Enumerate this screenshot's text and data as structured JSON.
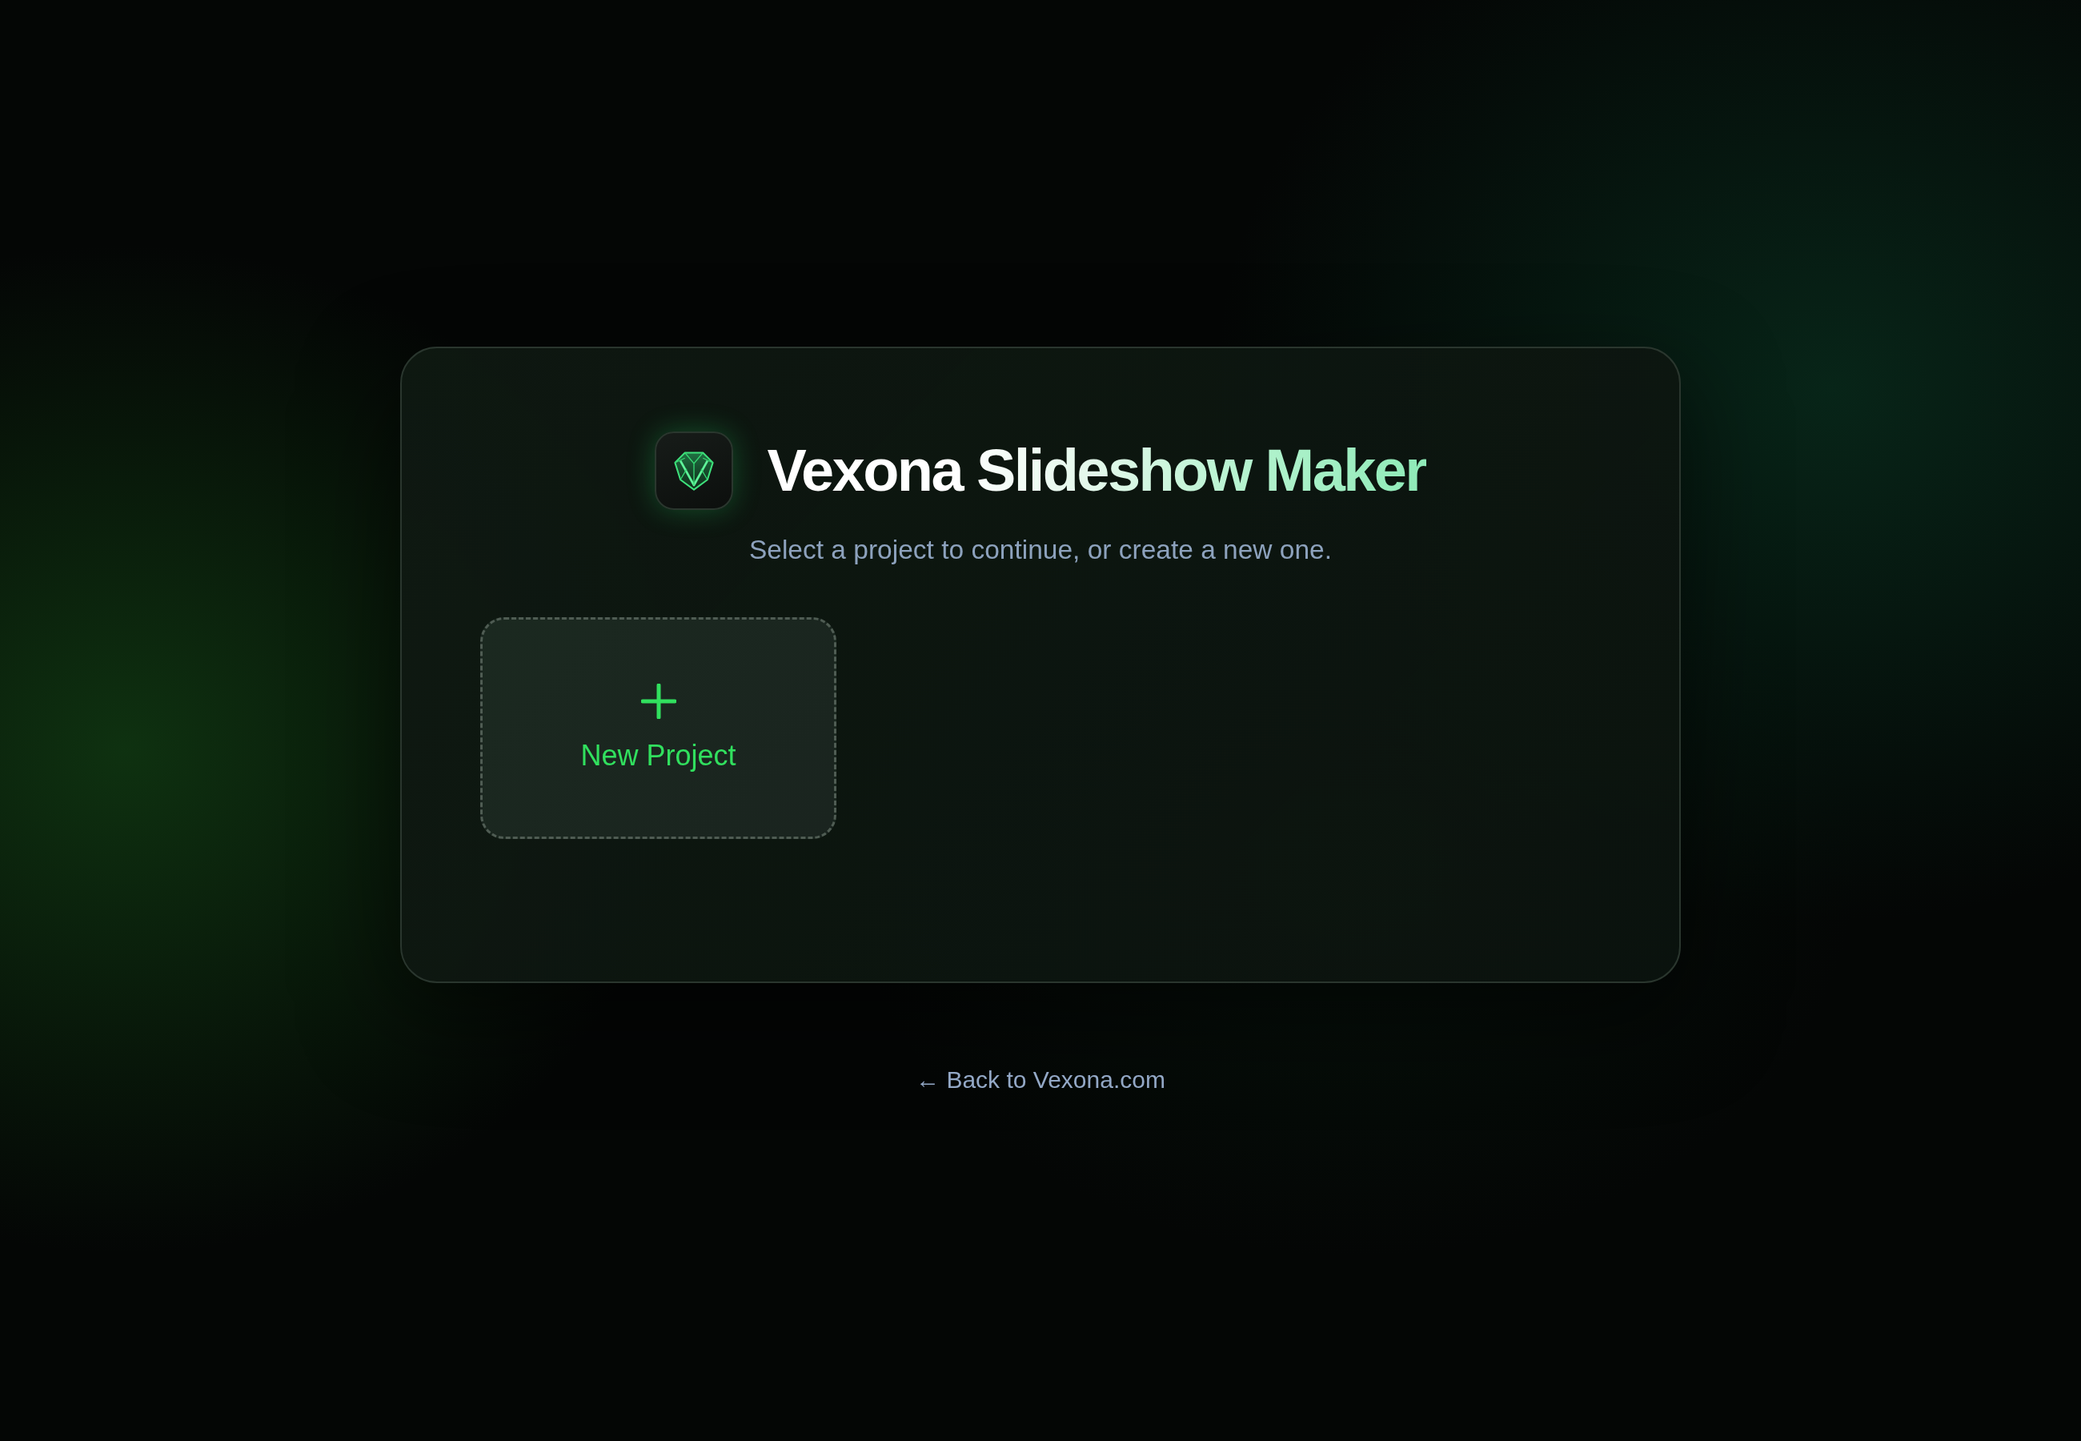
{
  "header": {
    "title": "Vexona Slideshow Maker",
    "subtitle": "Select a project to continue, or create a new one."
  },
  "projects": [
    {
      "kind": "new",
      "label": "New Project"
    }
  ],
  "footer_link": {
    "label": "← Back to Vexona.com"
  }
}
